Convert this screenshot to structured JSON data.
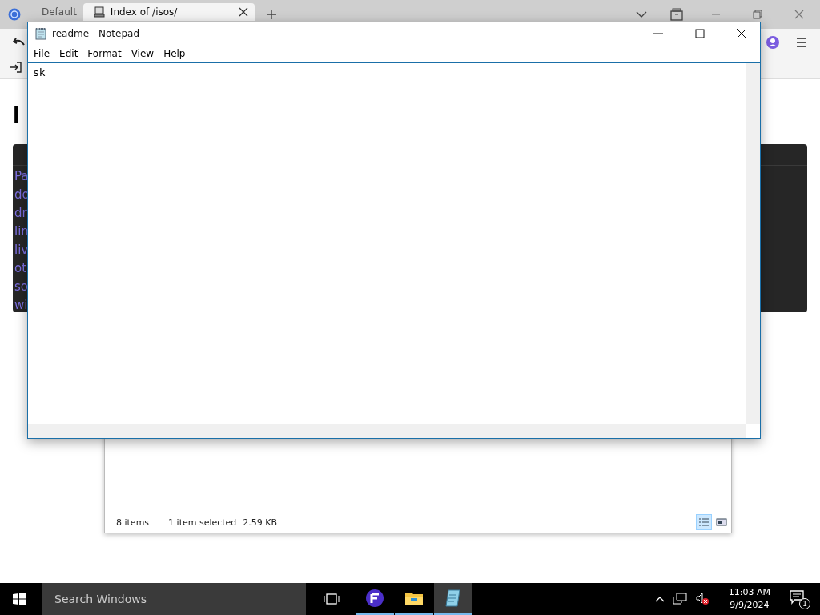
{
  "browser": {
    "tabs": [
      {
        "label": "Default",
        "selected": false
      },
      {
        "label": "Index of /isos/",
        "selected": true
      }
    ],
    "page": {
      "heading": "I",
      "panel_lines": [
        "Pa",
        "do",
        "dr",
        "lin",
        "liv",
        "ot",
        "so",
        "wi"
      ]
    }
  },
  "explorer": {
    "item_count": "8 items",
    "selection": "1 item selected",
    "size": "2.59 KB",
    "views": [
      {
        "kind": "details",
        "selected": true
      },
      {
        "kind": "large-icons",
        "selected": false
      }
    ]
  },
  "notepad": {
    "title": "readme - Notepad",
    "menu": [
      "File",
      "Edit",
      "Format",
      "View",
      "Help"
    ],
    "text": "sk"
  },
  "taskbar": {
    "search": {
      "placeholder": "Search Windows"
    },
    "apps": [
      {
        "kind": "app",
        "selected": false
      },
      {
        "kind": "files",
        "selected": false
      },
      {
        "kind": "notepad",
        "selected": true
      }
    ],
    "time": "11:03 AM",
    "date": "9/9/2024",
    "notifications": "1"
  }
}
